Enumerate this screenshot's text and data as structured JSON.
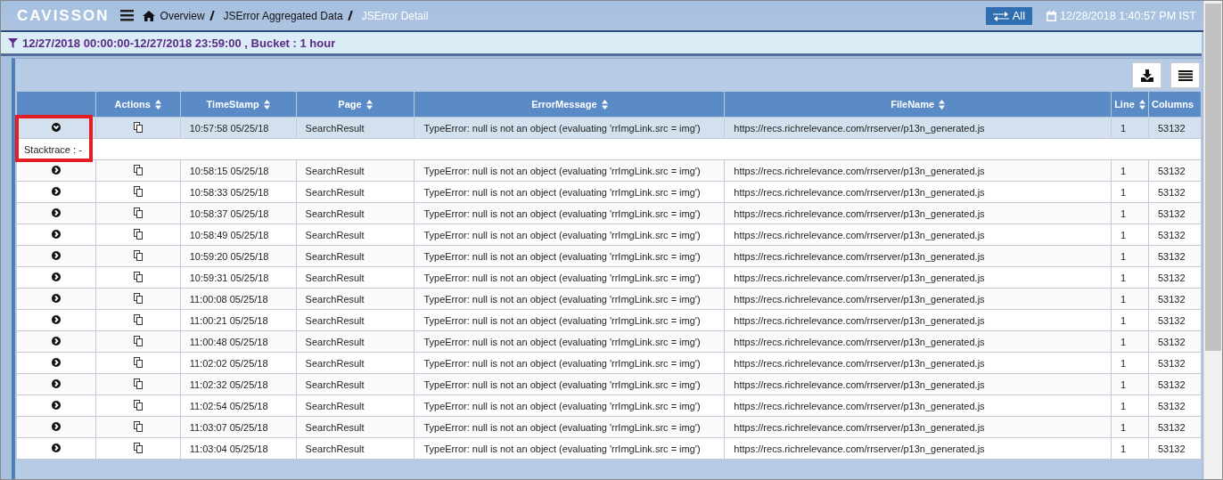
{
  "header": {
    "logo": "CAVISSON",
    "breadcrumb": [
      {
        "label": "Overview",
        "current": false
      },
      {
        "label": "JSError Aggregated Data",
        "current": false
      },
      {
        "label": "JSError Detail",
        "current": true
      }
    ],
    "all_button": "All",
    "datetime": "12/28/2018 1:40:57 PM IST"
  },
  "filter": {
    "text": "12/27/2018 00:00:00-12/27/2018 23:59:00 , Bucket : 1 hour"
  },
  "table": {
    "columns": [
      {
        "sortable": false
      },
      {
        "label": "Actions",
        "sortable": true
      },
      {
        "label": "TimeStamp",
        "sortable": true
      },
      {
        "label": "Page",
        "sortable": true
      },
      {
        "label": "ErrorMessage",
        "sortable": true
      },
      {
        "label": "FileName",
        "sortable": true
      },
      {
        "label": "Line",
        "sortable": true
      },
      {
        "label": "Columns",
        "sortable": false
      }
    ],
    "rows": [
      {
        "expanded": true,
        "selected": true,
        "timestamp": "10:57:58 05/25/18",
        "page": "SearchResult",
        "error": "TypeError: null is not an object (evaluating 'rrImgLink.src = img')",
        "file": "https://recs.richrelevance.com/rrserver/p13n_generated.js",
        "line": "1",
        "columns": "53132",
        "detail": "Stacktrace : -"
      },
      {
        "expanded": false,
        "selected": false,
        "timestamp": "10:58:15 05/25/18",
        "page": "SearchResult",
        "error": "TypeError: null is not an object (evaluating 'rrImgLink.src = img')",
        "file": "https://recs.richrelevance.com/rrserver/p13n_generated.js",
        "line": "1",
        "columns": "53132"
      },
      {
        "expanded": false,
        "selected": false,
        "timestamp": "10:58:33 05/25/18",
        "page": "SearchResult",
        "error": "TypeError: null is not an object (evaluating 'rrImgLink.src = img')",
        "file": "https://recs.richrelevance.com/rrserver/p13n_generated.js",
        "line": "1",
        "columns": "53132"
      },
      {
        "expanded": false,
        "selected": false,
        "timestamp": "10:58:37 05/25/18",
        "page": "SearchResult",
        "error": "TypeError: null is not an object (evaluating 'rrImgLink.src = img')",
        "file": "https://recs.richrelevance.com/rrserver/p13n_generated.js",
        "line": "1",
        "columns": "53132"
      },
      {
        "expanded": false,
        "selected": false,
        "timestamp": "10:58:49 05/25/18",
        "page": "SearchResult",
        "error": "TypeError: null is not an object (evaluating 'rrImgLink.src = img')",
        "file": "https://recs.richrelevance.com/rrserver/p13n_generated.js",
        "line": "1",
        "columns": "53132"
      },
      {
        "expanded": false,
        "selected": false,
        "timestamp": "10:59:20 05/25/18",
        "page": "SearchResult",
        "error": "TypeError: null is not an object (evaluating 'rrImgLink.src = img')",
        "file": "https://recs.richrelevance.com/rrserver/p13n_generated.js",
        "line": "1",
        "columns": "53132"
      },
      {
        "expanded": false,
        "selected": false,
        "timestamp": "10:59:31 05/25/18",
        "page": "SearchResult",
        "error": "TypeError: null is not an object (evaluating 'rrImgLink.src = img')",
        "file": "https://recs.richrelevance.com/rrserver/p13n_generated.js",
        "line": "1",
        "columns": "53132"
      },
      {
        "expanded": false,
        "selected": false,
        "timestamp": "11:00:08 05/25/18",
        "page": "SearchResult",
        "error": "TypeError: null is not an object (evaluating 'rrImgLink.src = img')",
        "file": "https://recs.richrelevance.com/rrserver/p13n_generated.js",
        "line": "1",
        "columns": "53132"
      },
      {
        "expanded": false,
        "selected": false,
        "timestamp": "11:00:21 05/25/18",
        "page": "SearchResult",
        "error": "TypeError: null is not an object (evaluating 'rrImgLink.src = img')",
        "file": "https://recs.richrelevance.com/rrserver/p13n_generated.js",
        "line": "1",
        "columns": "53132"
      },
      {
        "expanded": false,
        "selected": false,
        "timestamp": "11:00:48 05/25/18",
        "page": "SearchResult",
        "error": "TypeError: null is not an object (evaluating 'rrImgLink.src = img')",
        "file": "https://recs.richrelevance.com/rrserver/p13n_generated.js",
        "line": "1",
        "columns": "53132"
      },
      {
        "expanded": false,
        "selected": false,
        "timestamp": "11:02:02 05/25/18",
        "page": "SearchResult",
        "error": "TypeError: null is not an object (evaluating 'rrImgLink.src = img')",
        "file": "https://recs.richrelevance.com/rrserver/p13n_generated.js",
        "line": "1",
        "columns": "53132"
      },
      {
        "expanded": false,
        "selected": false,
        "timestamp": "11:02:32 05/25/18",
        "page": "SearchResult",
        "error": "TypeError: null is not an object (evaluating 'rrImgLink.src = img')",
        "file": "https://recs.richrelevance.com/rrserver/p13n_generated.js",
        "line": "1",
        "columns": "53132"
      },
      {
        "expanded": false,
        "selected": false,
        "timestamp": "11:02:54 05/25/18",
        "page": "SearchResult",
        "error": "TypeError: null is not an object (evaluating 'rrImgLink.src = img')",
        "file": "https://recs.richrelevance.com/rrserver/p13n_generated.js",
        "line": "1",
        "columns": "53132"
      },
      {
        "expanded": false,
        "selected": false,
        "timestamp": "11:03:07 05/25/18",
        "page": "SearchResult",
        "error": "TypeError: null is not an object (evaluating 'rrImgLink.src = img')",
        "file": "https://recs.richrelevance.com/rrserver/p13n_generated.js",
        "line": "1",
        "columns": "53132"
      },
      {
        "expanded": false,
        "selected": false,
        "timestamp": "11:03:04 05/25/18",
        "page": "SearchResult",
        "error": "TypeError: null is not an object (evaluating 'rrImgLink.src = img')",
        "file": "https://recs.richrelevance.com/rrserver/p13n_generated.js",
        "line": "1",
        "columns": "53132"
      }
    ]
  }
}
